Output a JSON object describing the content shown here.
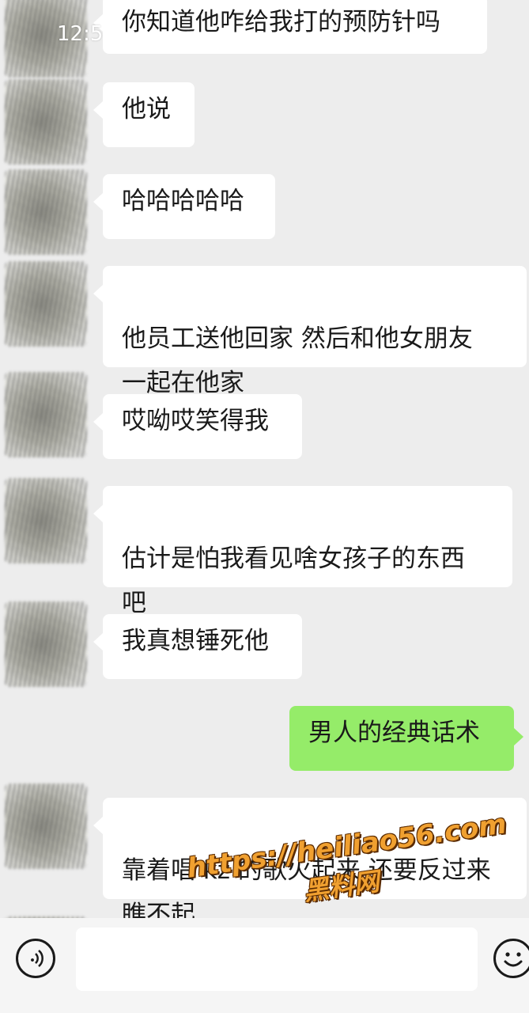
{
  "status_bar": {
    "time": "12:5"
  },
  "messages": [
    {
      "side": "left",
      "text": "你知道他咋给我打的预防针吗"
    },
    {
      "side": "left",
      "text": "他说"
    },
    {
      "side": "left",
      "text": "哈哈哈哈哈"
    },
    {
      "side": "left",
      "text": "他员工送他回家  然后和他女朋友\n一起在他家"
    },
    {
      "side": "left",
      "text": "哎呦哎笑得我"
    },
    {
      "side": "left",
      "text": "估计是怕我看见啥女孩子的东西\n吧"
    },
    {
      "side": "left",
      "text": "我真想锤死他"
    },
    {
      "side": "right",
      "text": "男人的经典话术"
    },
    {
      "side": "left",
      "text": "靠着唱 kz 的歌火起来 还要反过来\n瞧不起"
    }
  ],
  "watermark": {
    "url": "https://heiliao56.com",
    "name": "黑料网"
  },
  "input_bar": {
    "voice_icon": "voice-icon",
    "emoji_icon": "emoji-icon",
    "text_value": ""
  },
  "colors": {
    "chat_background": "#ededed",
    "incoming_bubble": "#ffffff",
    "outgoing_bubble": "#95ec69",
    "watermark": "#f0a030"
  }
}
